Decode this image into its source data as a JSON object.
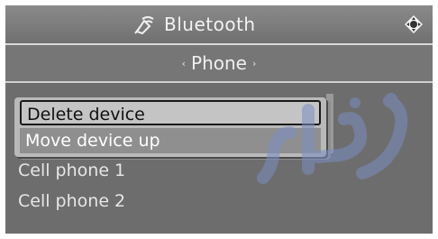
{
  "window": {
    "title": "Bluetooth",
    "title_icon": "bluetooth-signal-icon",
    "control_icon": "navigation-diamond-icon"
  },
  "tab": {
    "label": "Phone",
    "left_arrow": "‹",
    "right_arrow": "›"
  },
  "context_menu": {
    "items": [
      {
        "label": "Delete device",
        "selected": true
      },
      {
        "label": "Move device up",
        "selected": false
      }
    ]
  },
  "device_list": {
    "items": [
      {
        "label": "Cell phone 1"
      },
      {
        "label": "Cell phone 2"
      }
    ]
  },
  "colors": {
    "panel": "#6d6d6d",
    "menu_bg": "#b9b9b9",
    "watermark": "#7b8fc4"
  }
}
